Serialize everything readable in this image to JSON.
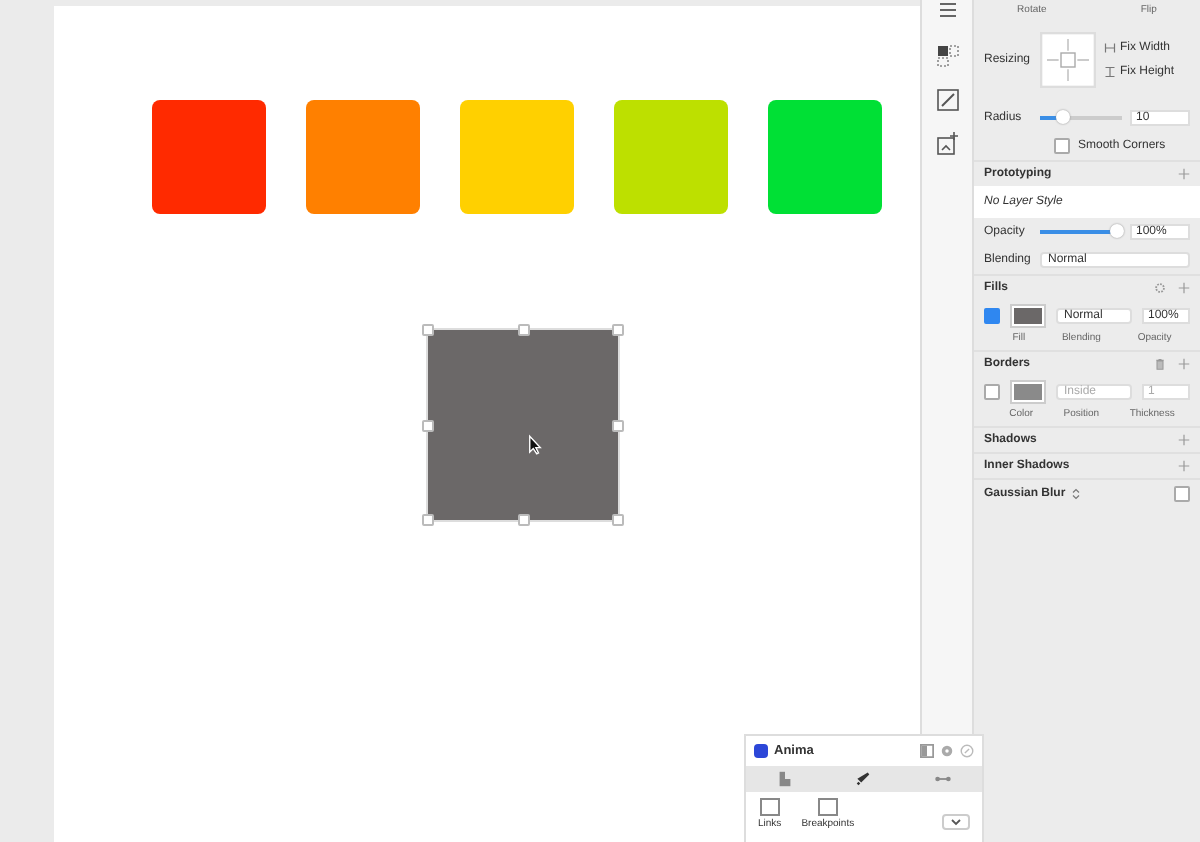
{
  "canvas": {
    "swatches": [
      {
        "color": "#ff2a00"
      },
      {
        "color": "#ff8000"
      },
      {
        "color": "#ffd000"
      },
      {
        "color": "#bde000"
      },
      {
        "color": "#00e035"
      }
    ],
    "selected_shape": {
      "color": "#6b6868"
    }
  },
  "inspector": {
    "top_labels": [
      "Rotate",
      "Flip"
    ],
    "resizing": {
      "label": "Resizing",
      "fix_width": "Fix Width",
      "fix_height": "Fix Height"
    },
    "radius": {
      "label": "Radius",
      "level": 0.3,
      "value": "10"
    },
    "smooth_corners": {
      "label": "Smooth Corners",
      "checked": false
    },
    "prototyping": {
      "title": "Prototyping"
    },
    "layer_style": {
      "value": "No Layer Style"
    },
    "opacity": {
      "label": "Opacity",
      "level": 0.95,
      "value": "100%"
    },
    "blending": {
      "label": "Blending",
      "value": "Normal"
    },
    "fills": {
      "title": "Fills",
      "items": [
        {
          "enabled": true,
          "color": "#6b6868",
          "blend": "Normal",
          "opacity": "100%"
        }
      ],
      "captions": [
        "Fill",
        "Blending",
        "Opacity"
      ]
    },
    "borders": {
      "title": "Borders",
      "items": [
        {
          "enabled": false,
          "color": "#8a8a8a",
          "position": "Inside",
          "thickness": "1"
        }
      ],
      "captions": [
        "Color",
        "Position",
        "Thickness"
      ]
    },
    "sections": [
      "Shadows",
      "Inner Shadows"
    ],
    "gaussian_blur": {
      "label": "Gaussian Blur",
      "checked": false
    }
  },
  "anima": {
    "title": "Anima",
    "tools": [
      {
        "label": "Links"
      },
      {
        "label": "Breakpoints"
      }
    ]
  }
}
